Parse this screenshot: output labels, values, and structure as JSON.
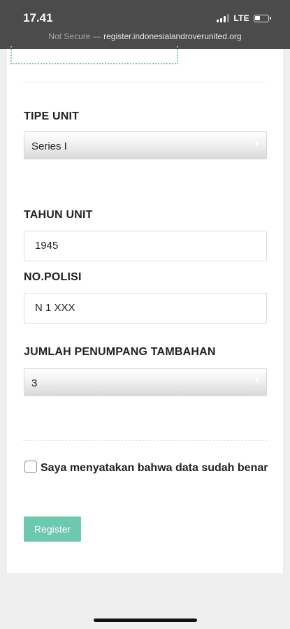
{
  "status_bar": {
    "time": "17.41",
    "network": "LTE",
    "signal_bars_active": 3,
    "battery_level": 0.4
  },
  "browser": {
    "security_label": "Not Secure",
    "separator": " — ",
    "url": "register.indonesialandroverunited.org"
  },
  "form": {
    "tipe_unit": {
      "label": "TIPE UNIT",
      "selected": "Series I",
      "chevron_icon": "chevron-down-icon"
    },
    "tahun_unit": {
      "label": "TAHUN UNIT",
      "value": "1945"
    },
    "no_polisi": {
      "label": "NO.POLISI",
      "value": "N 1 XXX"
    },
    "jumlah_penumpang": {
      "label": "JUMLAH PENUMPANG TAMBAHAN",
      "selected": "3",
      "chevron_icon": "chevron-down-icon"
    },
    "confirmation": {
      "label": "Saya menyatakan bahwa data sudah benar",
      "checked": false
    },
    "register_button": {
      "label": "Register",
      "color": "#6cc8ae"
    }
  },
  "colors": {
    "status_bar_bg": "#4b4b4b",
    "page_bg": "#efefef",
    "accent": "#6cc8ae"
  }
}
